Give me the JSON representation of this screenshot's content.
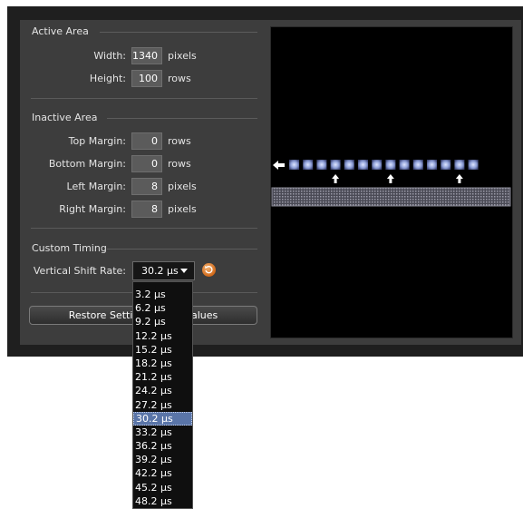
{
  "active_area": {
    "title": "Active Area",
    "width_label": "Width:",
    "width_value": "1340",
    "width_unit": "pixels",
    "height_label": "Height:",
    "height_value": "100",
    "height_unit": "rows"
  },
  "inactive_area": {
    "title": "Inactive Area",
    "top_label": "Top Margin:",
    "top_value": "0",
    "top_unit": "rows",
    "bottom_label": "Bottom Margin:",
    "bottom_value": "0",
    "bottom_unit": "rows",
    "left_label": "Left Margin:",
    "left_value": "8",
    "left_unit": "pixels",
    "right_label": "Right Margin:",
    "right_value": "8",
    "right_unit": "pixels"
  },
  "custom_timing": {
    "title": "Custom Timing",
    "shift_label": "Vertical Shift Rate:",
    "shift_value": "30.2 µs",
    "options": [
      "3.2 µs",
      "6.2 µs",
      "9.2 µs",
      "12.2 µs",
      "15.2 µs",
      "18.2 µs",
      "21.2 µs",
      "24.2 µs",
      "27.2 µs",
      "30.2 µs",
      "33.2 µs",
      "36.2 µs",
      "39.2 µs",
      "42.2 µs",
      "45.2 µs",
      "48.2 µs"
    ],
    "selected_index": 9
  },
  "restore_button": {
    "label_left": "Restore Setting",
    "label_right": "Values"
  },
  "preview": {
    "pixel_count": 14,
    "up_arrow_positions": [
      3,
      7,
      12
    ],
    "colors": {
      "pixel": "#8fa0d8",
      "register": "#6b6b78",
      "arrow": "#ffffff"
    }
  },
  "icons": {
    "refresh": "refresh-icon",
    "dropdown": "chevron-down-icon",
    "shift_left": "arrow-left-icon",
    "shift_up": "arrow-up-icon"
  }
}
